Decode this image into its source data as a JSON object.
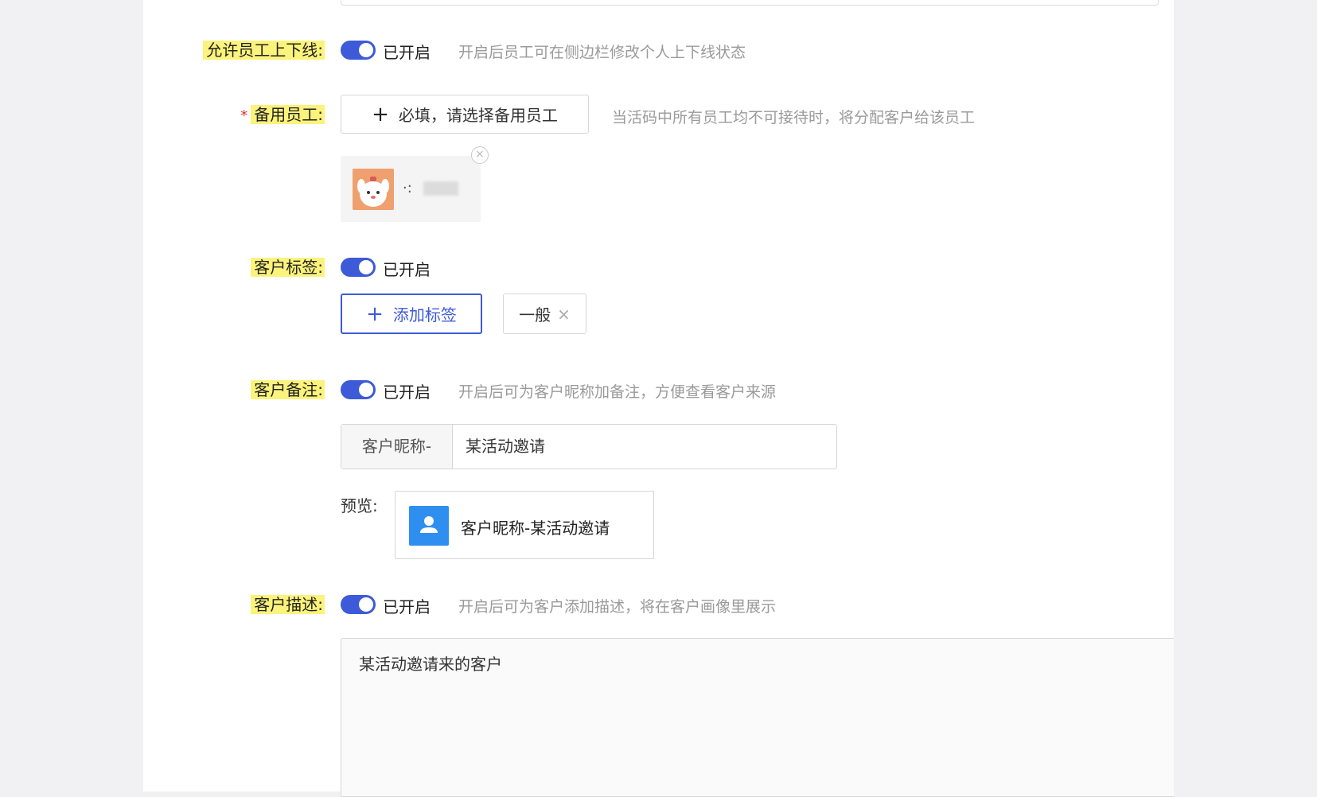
{
  "colors": {
    "accent": "#3d5ad8",
    "highlight": "#fbf37b",
    "required": "#e0301e"
  },
  "allow_online": {
    "label": "允许员工上下线:",
    "state": "已开启",
    "enabled": true,
    "hint": "开启后员工可在侧边栏修改个人上下线状态"
  },
  "backup_staff": {
    "required_mark": "*",
    "label": "备用员工:",
    "select_button": "必填，请选择备用员工",
    "hint": "当活码中所有员工均不可接待时，将分配客户给该员工"
  },
  "customer_tags": {
    "label": "客户标签:",
    "state": "已开启",
    "enabled": true,
    "add_button": "添加标签",
    "tags": [
      "一般"
    ]
  },
  "customer_remark": {
    "label": "客户备注:",
    "state": "已开启",
    "enabled": true,
    "hint": "开启后可为客户昵称加备注，方便查看客户来源",
    "prefix": "客户昵称-",
    "value": "某活动邀请",
    "preview_label": "预览:",
    "preview_text": "客户昵称-某活动邀请"
  },
  "customer_desc": {
    "label": "客户描述:",
    "state": "已开启",
    "enabled": true,
    "hint": "开启后可为客户添加描述，将在客户画像里展示",
    "value": "某活动邀请来的客户"
  }
}
